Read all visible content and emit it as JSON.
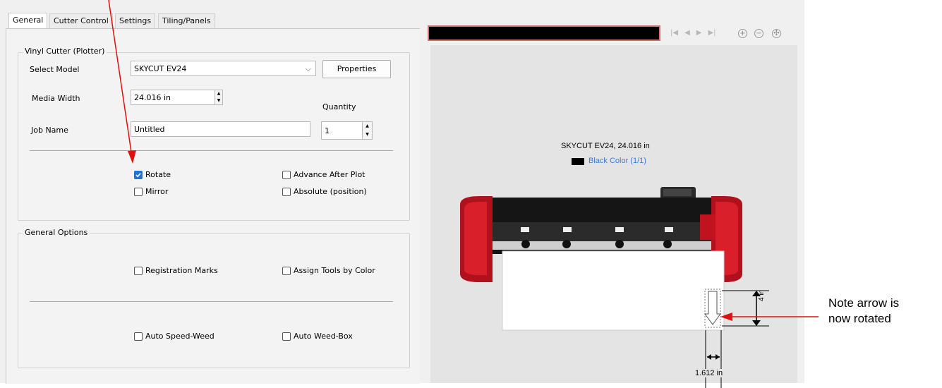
{
  "tabs": [
    "General",
    "Cutter Control",
    "Settings",
    "Tiling/Panels"
  ],
  "vinyl_group": {
    "title": "Vinyl Cutter (Plotter)",
    "select_model_label": "Select Model",
    "model_value": "SKYCUT EV24",
    "properties_button": "Properties",
    "media_width_label": "Media Width",
    "media_width_value": "24.016 in",
    "quantity_label": "Quantity",
    "quantity_value": "1",
    "job_name_label": "Job Name",
    "job_name_value": "Untitled",
    "rotate_label": "Rotate",
    "rotate_checked": true,
    "mirror_label": "Mirror",
    "advance_label": "Advance After Plot",
    "absolute_label": "Absolute (position)"
  },
  "general_options": {
    "title": "General Options",
    "registration_label": "Registration Marks",
    "assign_tools_label": "Assign Tools by Color",
    "auto_speed_weed_label": "Auto Speed-Weed",
    "auto_weed_box_label": "Auto Weed-Box"
  },
  "preview": {
    "machine_caption": "SKYCUT EV24,  24.016 in",
    "color_label": "Black Color (1/1)",
    "height_dim": "4 in",
    "width_dim": "1.612 in",
    "accent_color": "#c0121f",
    "link_color": "#3a7bd5"
  },
  "annotation": {
    "note_line1": "Note arrow is",
    "note_line2": "now rotated"
  }
}
